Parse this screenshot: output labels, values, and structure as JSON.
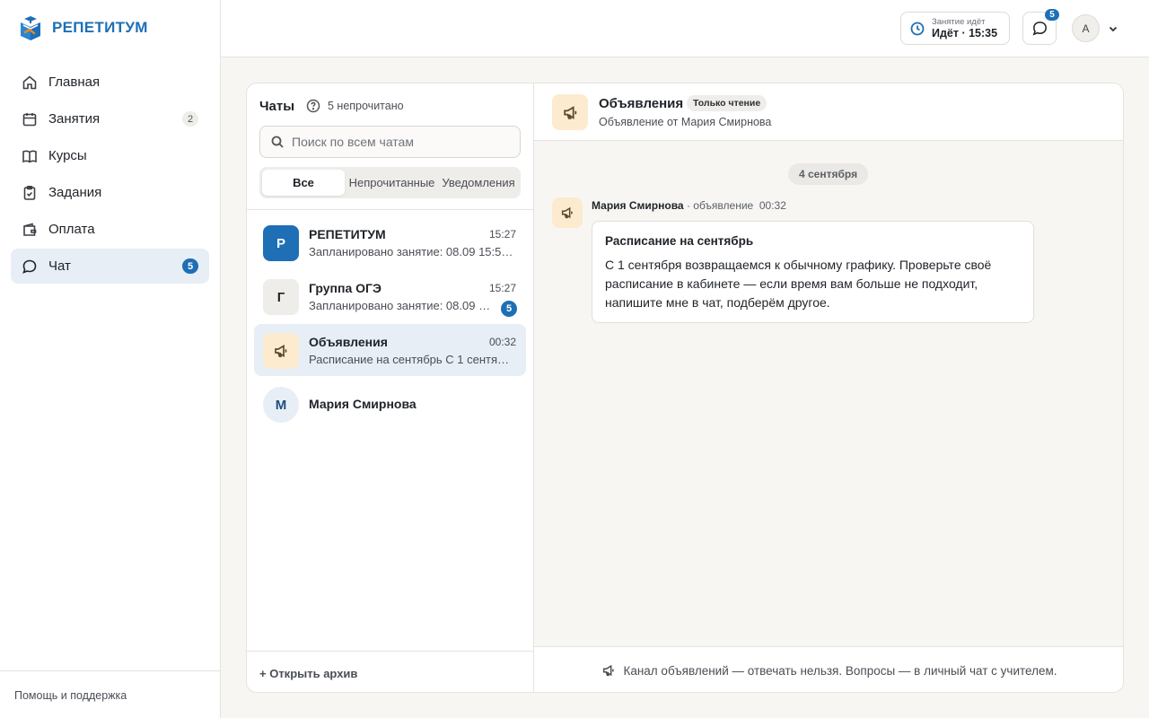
{
  "app": {
    "brand": "РЕПЕТИТУМ",
    "brand_color": "#1e6fb5"
  },
  "sidebar": {
    "items": [
      {
        "label": "Главная",
        "icon": "home-icon",
        "count": ""
      },
      {
        "label": "Занятия",
        "icon": "calendar-icon",
        "count": "2"
      },
      {
        "label": "Курсы",
        "icon": "book-icon",
        "count": ""
      },
      {
        "label": "Задания",
        "icon": "clipboard-icon",
        "count": ""
      },
      {
        "label": "Оплата",
        "icon": "wallet-icon",
        "count": ""
      },
      {
        "label": "Чат",
        "icon": "chat-icon",
        "count": "5",
        "active": true
      }
    ],
    "footer": "Помощь и поддержка"
  },
  "topbar": {
    "lesson_status_small": "Занятие идёт",
    "lesson_status": "Идёт · 15:35",
    "chat_badge": "5",
    "avatar_initial": "A"
  },
  "chats": {
    "title": "Чаты",
    "unread_summary": "5 непрочитано",
    "search_placeholder": "Поиск по всем чатам",
    "filters": [
      "Все",
      "Непрочитанные",
      "Уведомления"
    ],
    "active_filter": "Все",
    "list": [
      {
        "name": "РЕПЕТИТУМ",
        "time": "15:27",
        "preview": "Запланировано занятие: 08.09 15:5…",
        "avatar": "Р",
        "unread": ""
      },
      {
        "name": "Группа ОГЭ",
        "time": "15:27",
        "preview": "Запланировано занятие: 08.09 …",
        "avatar": "Г",
        "unread": "5"
      },
      {
        "name": "Объявления",
        "time": "00:32",
        "preview": "Расписание на сентябрь С 1 сентяб…",
        "avatar": "megaphone-icon",
        "unread": "",
        "selected": true
      },
      {
        "name": "Мария Смирнова",
        "time": "",
        "preview": "",
        "avatar": "М",
        "unread": ""
      }
    ],
    "archive_link": "+ Открыть архив"
  },
  "conversation": {
    "title": "Объявления",
    "badge": "Только чтение",
    "subtitle": "Объявление от Мария Смирнова",
    "date_divider": "4 сентября",
    "message": {
      "author": "Мария Смирнова",
      "kind": "· объявление",
      "time": "00:32",
      "title": "Расписание на сентябрь",
      "text": "С 1 сентября возвращаемся к обычному графику. Проверьте своё расписание в кабинете — если время вам больше не подходит, напишите мне в чат, подберём другое."
    },
    "footer_note": "Канал объявлений — отвечать нельзя. Вопросы — в личный чат с учителем."
  }
}
